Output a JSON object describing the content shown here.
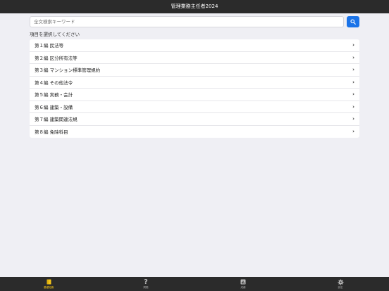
{
  "header": {
    "title": "管理業務主任者2024"
  },
  "search": {
    "placeholder": "全文検索キーワード"
  },
  "prompt": "項目を選択してください",
  "items": [
    {
      "label": "第１編 民法等"
    },
    {
      "label": "第２編 区分所有法等"
    },
    {
      "label": "第３編 マンション標準管理規約"
    },
    {
      "label": "第４編 その他法令"
    },
    {
      "label": "第５編 実務・会計"
    },
    {
      "label": "第６編 建築・設備"
    },
    {
      "label": "第７編 建築関連法規"
    },
    {
      "label": "第８編 免除科目"
    }
  ],
  "tabs": [
    {
      "label": "基礎知識",
      "icon": "book-icon",
      "active": true
    },
    {
      "label": "問題",
      "icon": "question-icon",
      "active": false
    },
    {
      "label": "成績",
      "icon": "chart-icon",
      "active": false
    },
    {
      "label": "設定",
      "icon": "gear-icon",
      "active": false
    }
  ],
  "colors": {
    "accent": "#1a73e8",
    "active_tab": "#f5c518",
    "bar": "#2b2b2b"
  }
}
